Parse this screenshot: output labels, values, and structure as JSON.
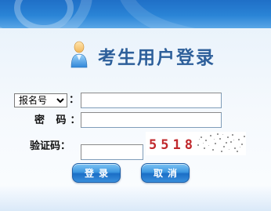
{
  "title": "考生用户登录",
  "login_type": {
    "selected": "报名号",
    "colon": "："
  },
  "password_label": "密 码：",
  "captcha_label": "验证码：",
  "captcha_value": "5518",
  "fields": {
    "username_value": "",
    "password_value": "",
    "captcha_input_value": ""
  },
  "buttons": {
    "login": "登录",
    "cancel": "取消"
  },
  "colors": {
    "title": "#2d5f9a",
    "banner": "#2a84d6",
    "captcha_text": "#c0282c",
    "button": "#3d97e0"
  },
  "icons": {
    "user": "user-icon"
  }
}
